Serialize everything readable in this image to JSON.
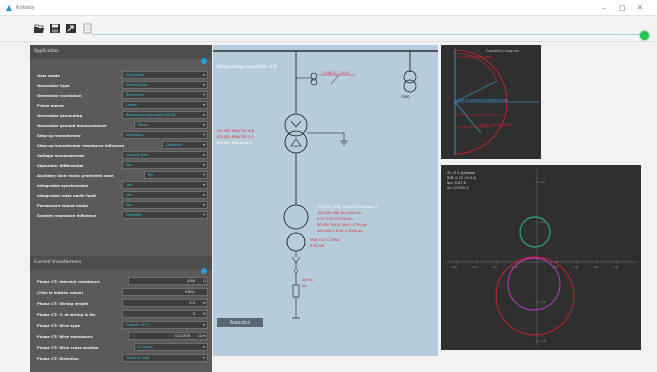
{
  "window": {
    "title": "Kirkeby",
    "controls": [
      "–",
      "□",
      "✕"
    ]
  },
  "toolbar": {
    "buttons": [
      "open-icon",
      "save-icon",
      "export-icon",
      "document-icon"
    ],
    "status_color": "#22c255"
  },
  "application": {
    "title": "Application",
    "rows": [
      {
        "label": "User mode",
        "value": "Simplified"
      },
      {
        "label": "Generator type",
        "value": "Salient pole"
      },
      {
        "label": "Generator excitation",
        "value": "Brushless"
      },
      {
        "label": "Prime mover",
        "value": "Diesel"
      },
      {
        "label": "Generator grounding",
        "value": "Resistance grounded (NGR)"
      },
      {
        "label": "Generator ground measurement",
        "value": "None"
      },
      {
        "label": "Step-up transformer",
        "value": "Individual"
      },
      {
        "label": "Step-up transformer reactance influence",
        "value": "Disabled"
      },
      {
        "label": "Voltage measurement",
        "value": "Ground wye"
      },
      {
        "label": "Separator differential",
        "value": "No"
      },
      {
        "label": "Auxiliary load ready protected zone",
        "value": "No"
      },
      {
        "label": "Integrated synchronizer",
        "value": "Yes"
      },
      {
        "label": "Integrated rotor earth fault",
        "value": "No"
      },
      {
        "label": "Permanent island mode",
        "value": "No"
      },
      {
        "label": "System reactance influence",
        "value": "Disabled"
      }
    ]
  },
  "current_transformers": {
    "title": "Current transformers",
    "rows": [
      {
        "label": "Phase CT: Internal resistance",
        "value": "0.80",
        "unit": "Ω"
      },
      {
        "label": "(This is hidden value)",
        "value": "0.801",
        "unit": ""
      },
      {
        "label": "Phase CT: Wiring length",
        "value": "3.0",
        "unit": "m"
      },
      {
        "label": "Phase CT: % of wiring is for",
        "value": "5",
        "unit": "%"
      },
      {
        "label": "Phase CT: Wire type",
        "value": "Copper 75°C",
        "unit": ""
      },
      {
        "label": "Phase CT: Wire resistance",
        "value": "0.01200",
        "unit": "Ω/m"
      },
      {
        "label": "Phase CT: Wire cross section",
        "value": "4.0mm2",
        "unit": ""
      },
      {
        "label": "Phase CT: Direction",
        "value": "Towards load",
        "unit": ""
      }
    ]
  },
  "diagram": {
    "bus_label": "Relay voltage connection: 8.8",
    "grid_label": "GRID",
    "ct_label": "1,500 A / 110 V",
    "ct_sub": "N.A",
    "transformer_lines": [
      "100.000 MVA/TSC 6.8",
      "100.000 MVA/TSC 0.1",
      "400.000 MVA base 1"
    ],
    "generator_lines": [
      "103.000 MVA, 260.000 MW base 1",
      "105.000 MW 30 1.000 pu",
      "0.27 0.00 0.2790 pu",
      "40.000 500 0.300 0.1750 pu",
      "200.000 1.6 kV 0.7000 pu"
    ],
    "generator_extra": [
      "MVA 0.0 0.1 MVA",
      "0 60 kW"
    ],
    "breaker_labels": [
      "10 ms",
      "20"
    ],
    "protection_button": "Protection",
    "colors": {
      "panel": "#b7ccdb",
      "line": "#111111",
      "highlight": "#d8202e"
    }
  },
  "plot_capability": {
    "title": "Capability diagram",
    "labels": [
      "Over excitation limit",
      "Line of under-excitation limit",
      "Stator current limit"
    ]
  },
  "plot_impedance": {
    "info": [
      "Zn: 5.4 Ω/phase",
      "X/R: 0.72 / 0.9 Ω",
      "Ipu: 0.87 A",
      "Vn: 11000 V"
    ],
    "axis_ticks_x": [
      "-2.0",
      "-1.5",
      "-1.0",
      "-0.5",
      "0.5",
      "1.0",
      "1.5",
      "2.0"
    ],
    "axis_ticks_y": [
      "2.0",
      "1.0",
      "-1.0",
      "-2.0",
      "-3.0"
    ]
  }
}
